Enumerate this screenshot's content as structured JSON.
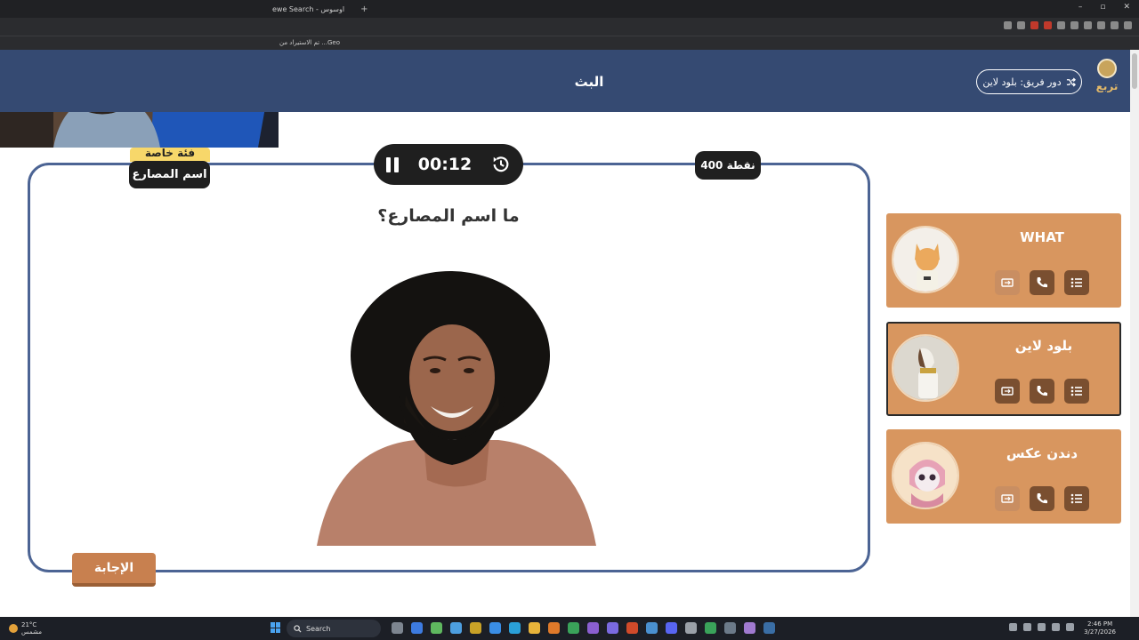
{
  "browser": {
    "tab_title": "ewe Search - اوسوس",
    "new_tab_symbol": "+",
    "bookmark_text": "تم الاستيراد من ...Geo"
  },
  "header": {
    "title": "البث",
    "team_turn_label": "دور فريق: بلود لاين",
    "logo_text": "تربع"
  },
  "question": {
    "category_label": "فئة خاصة",
    "category_name": "اسم المصارع",
    "timer": "00:12",
    "points": "400 نقطة",
    "text": "ما اسم المصارع؟",
    "answer_button": "الإجابة"
  },
  "teams": [
    {
      "name": "WHAT",
      "active": false,
      "swap_disabled": true
    },
    {
      "name": "بلود لاين",
      "active": true,
      "swap_disabled": false
    },
    {
      "name": "دندن عكس",
      "active": false,
      "swap_disabled": true
    }
  ],
  "taskbar": {
    "weather_temp": "21°C",
    "weather_desc": "مشمس",
    "search_placeholder": "Search",
    "time": "2:46 PM",
    "date": "3/27/2026"
  },
  "colors": {
    "header_bg": "#354a72",
    "card_border": "#4c6494",
    "team_card": "#d8965f",
    "action_button": "#7a4f30",
    "answer_button": "#c8804f"
  }
}
